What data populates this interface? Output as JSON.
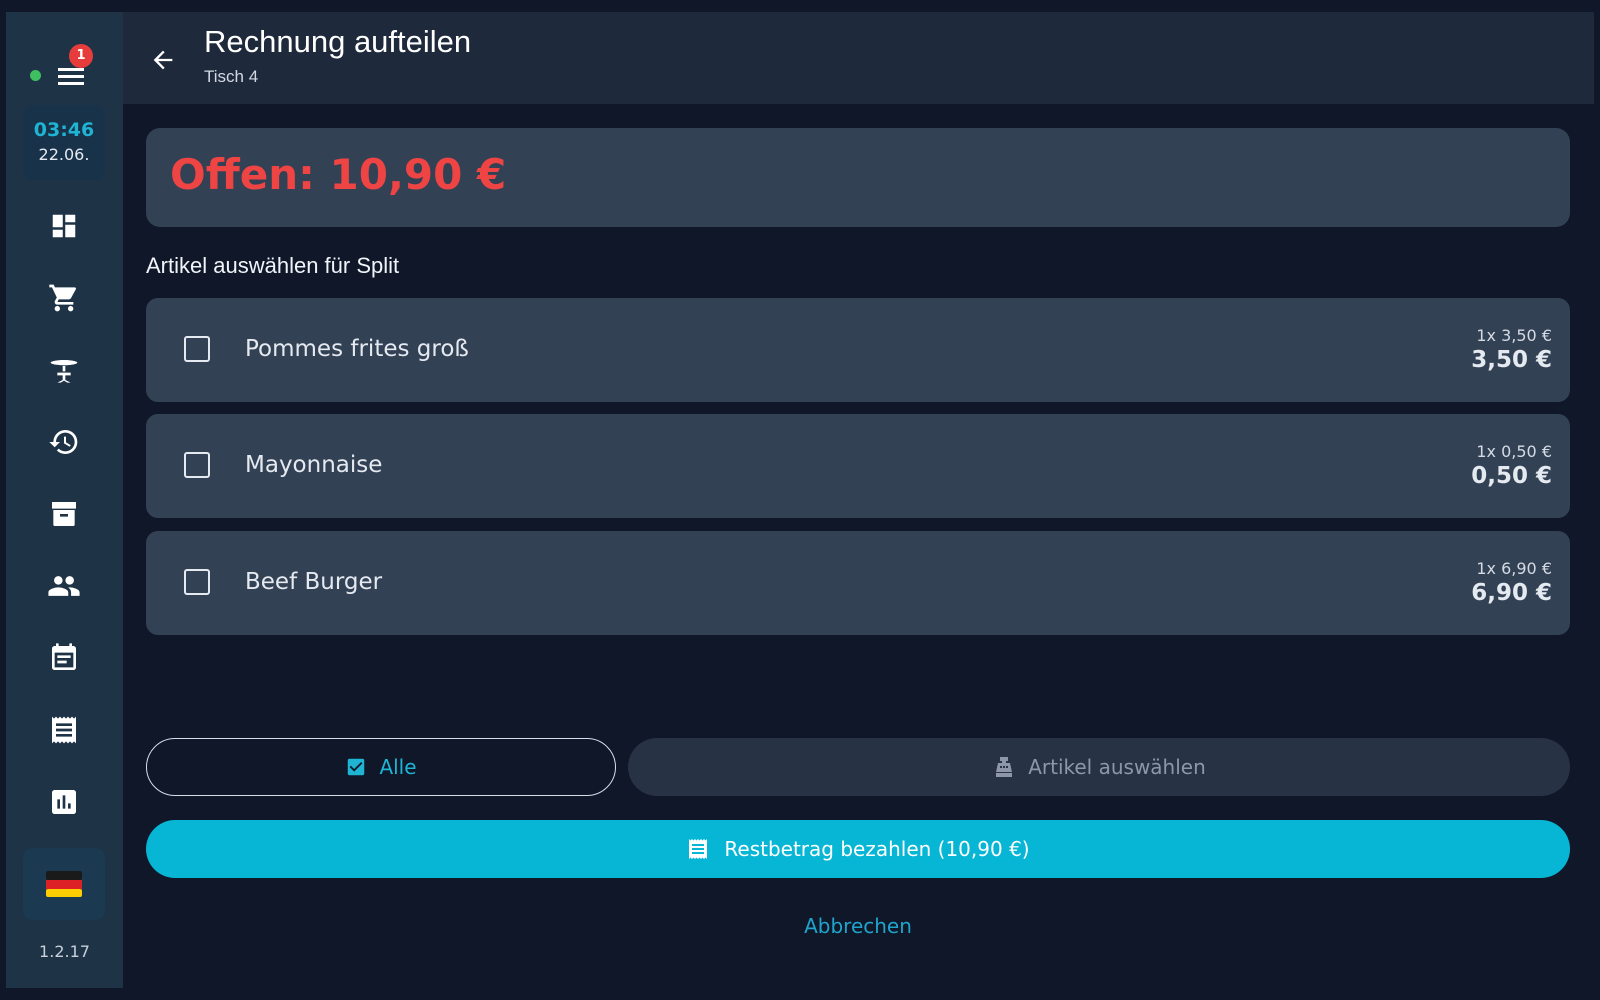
{
  "sidebar": {
    "menu_badge": "1",
    "clock_time": "03:46",
    "clock_date": "22.06.",
    "nav_items": [
      {
        "icon": "dashboard-icon"
      },
      {
        "icon": "cart-icon"
      },
      {
        "icon": "table-icon"
      },
      {
        "icon": "history-icon"
      },
      {
        "icon": "archive-icon"
      },
      {
        "icon": "people-icon"
      },
      {
        "icon": "calendar-icon"
      },
      {
        "icon": "receipt-icon"
      },
      {
        "icon": "chart-icon"
      }
    ],
    "language_flag": "🇩🇪",
    "version": "1.2.17"
  },
  "header": {
    "title": "Rechnung aufteilen",
    "subtitle": "Tisch 4"
  },
  "summary": {
    "open_label": "Offen: 10,90 €"
  },
  "section_title": "Artikel auswählen für Split",
  "items": [
    {
      "name": "Pommes frites groß",
      "unit": "1x 3,50 €",
      "total": "3,50 €",
      "checked": false
    },
    {
      "name": "Mayonnaise",
      "unit": "1x 0,50 €",
      "total": "0,50 €",
      "checked": false
    },
    {
      "name": "Beef Burger",
      "unit": "1x 6,90 €",
      "total": "6,90 €",
      "checked": false
    }
  ],
  "actions": {
    "all_label": "Alle",
    "select_items_label": "Artikel auswählen",
    "pay_rest_label": "Restbetrag bezahlen (10,90 €)",
    "cancel_label": "Abbrechen"
  },
  "colors": {
    "accent": "#06b6d4",
    "danger": "#ef4444",
    "card": "#334155",
    "background": "#0f1729"
  }
}
